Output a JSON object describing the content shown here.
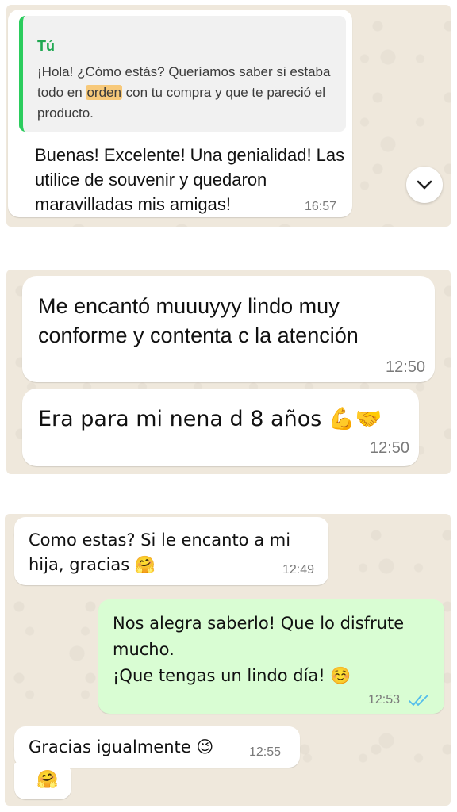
{
  "panel1": {
    "quote_author": "Tú",
    "quote_text_before": "¡Hola! ¿Cómo estás? Queríamos saber si estaba todo en ",
    "quote_highlight": "orden",
    "quote_text_after": " con tu compra y que te pareció el producto.",
    "message": "Buenas! Excelente! Una genialidad! Las utilice de souvenir y quedaron maravilladas mis amigas!",
    "time": "16:57",
    "scroll_icon": "chevron-down-icon"
  },
  "panel2": {
    "message1": "Me encantó muuuyyy lindo muy conforme y contenta c la atención",
    "time1": "12:50",
    "message2": "Era para mi nena d 8 años 💪🤝",
    "time2": "12:50"
  },
  "panel3": {
    "message1": "Como estas? Si le encanto a mi hija, gracias 🤗",
    "time1": "12:49",
    "reply_line1": "Nos alegra saberlo! Que lo disfrute mucho.",
    "reply_line2": "¡Que tengas un lindo día! ☺️",
    "time2": "12:53",
    "read_status_icon": "double-check-icon",
    "read_color": "#53bdeb",
    "message3": "Gracias igualmente 😉",
    "time3": "12:55",
    "message4": "🤗"
  },
  "colors": {
    "incoming_bubble": "#ffffff",
    "outgoing_bubble": "#d9fdd3",
    "quote_bar": "#2bcc5d",
    "chat_background": "#efe8dc"
  }
}
